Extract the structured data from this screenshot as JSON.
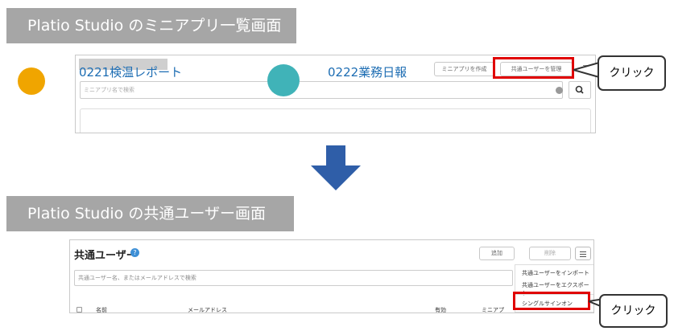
{
  "banners": {
    "top": "Platio Studio のミニアプリ一覧画面",
    "bottom": "Platio Studio の共通ユーザー画面"
  },
  "panel1": {
    "create_label": "ミニアプリを作成",
    "shared_label": "共通ユーザーを管理",
    "search_placeholder": "ミニアプリ名で検索",
    "cards": [
      {
        "title": "0221検温レポート"
      },
      {
        "title": "0222業務日報"
      }
    ]
  },
  "panel2": {
    "title": "共通ユーザー",
    "add_label": "追加",
    "delete_label": "削除",
    "search_placeholder": "共通ユーザー名、またはメールアドレスで検索",
    "menu_items": [
      "共通ユーザーをインポート",
      "共通ユーザーをエクスポート",
      "シングルサインオン"
    ],
    "columns": [
      "名前",
      "メールアドレス",
      "有効",
      "ミニアプ"
    ]
  },
  "callouts": {
    "first": "クリック",
    "second": "クリック"
  },
  "colors": {
    "highlight": "#e00000",
    "arrow": "#2f5ea8",
    "banner": "#a6a6a6",
    "link": "#1d6db3"
  }
}
